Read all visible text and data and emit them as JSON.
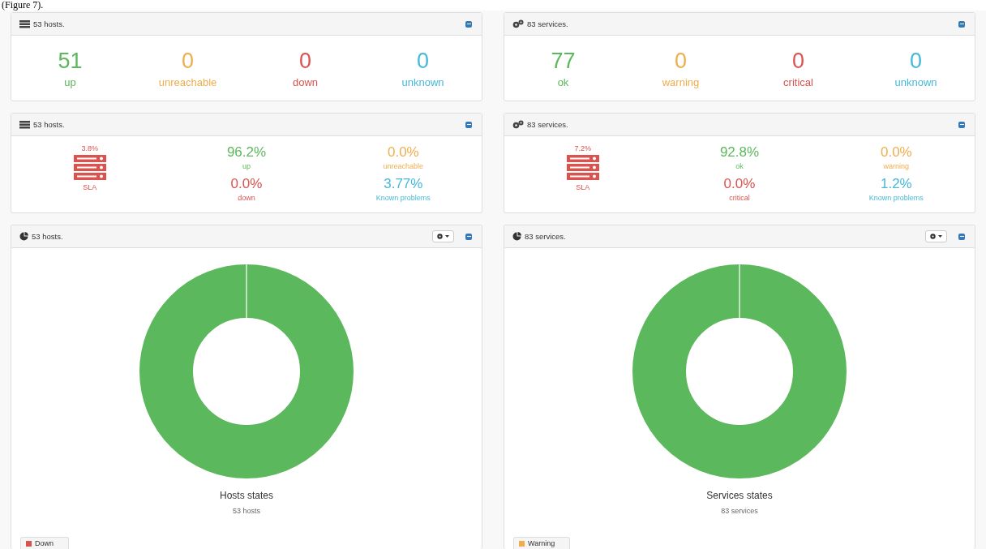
{
  "caption": "(Figure 7).",
  "columns": [
    {
      "counts_panel": {
        "title": "53 hosts.",
        "kind": "hosts",
        "stats": [
          {
            "value": "51",
            "label": "up",
            "color": "#5cb85c"
          },
          {
            "value": "0",
            "label": "unreachable",
            "color": "#f0ad4e"
          },
          {
            "value": "0",
            "label": "down",
            "color": "#d9534f"
          },
          {
            "value": "0",
            "label": "unknown",
            "color": "#46b8da"
          }
        ]
      },
      "sla_panel": {
        "title": "53 hosts.",
        "kind": "hosts",
        "sla_value": "3.8%",
        "sla_label": "SLA",
        "stats": [
          {
            "value": "96.2%",
            "label": "up",
            "color": "#5cb85c"
          },
          {
            "value": "0.0%",
            "label": "unreachable",
            "color": "#f0ad4e"
          },
          {
            "value": "0.0%",
            "label": "down",
            "color": "#d9534f"
          },
          {
            "value": "3.77%",
            "label": "Known problems",
            "color": "#46b8da"
          }
        ]
      },
      "chart_panel": {
        "title": "53 hosts.",
        "chart_title": "Hosts states",
        "chart_subtitle": "53 hosts",
        "legend": [
          {
            "label": "Down",
            "color": "#d9534f"
          }
        ]
      }
    },
    {
      "counts_panel": {
        "title": "83 services.",
        "kind": "services",
        "stats": [
          {
            "value": "77",
            "label": "ok",
            "color": "#5cb85c"
          },
          {
            "value": "0",
            "label": "warning",
            "color": "#f0ad4e"
          },
          {
            "value": "0",
            "label": "critical",
            "color": "#d9534f"
          },
          {
            "value": "0",
            "label": "unknown",
            "color": "#46b8da"
          }
        ]
      },
      "sla_panel": {
        "title": "83 services.",
        "kind": "services",
        "sla_value": "7.2%",
        "sla_label": "SLA",
        "stats": [
          {
            "value": "92.8%",
            "label": "ok",
            "color": "#5cb85c"
          },
          {
            "value": "0.0%",
            "label": "warning",
            "color": "#f0ad4e"
          },
          {
            "value": "0.0%",
            "label": "critical",
            "color": "#d9534f"
          },
          {
            "value": "1.2%",
            "label": "Known problems",
            "color": "#46b8da"
          }
        ]
      },
      "chart_panel": {
        "title": "83 services.",
        "chart_title": "Services states",
        "chart_subtitle": "83 services",
        "legend": [
          {
            "label": "Warning",
            "color": "#f0ad4e"
          }
        ]
      }
    }
  ]
}
